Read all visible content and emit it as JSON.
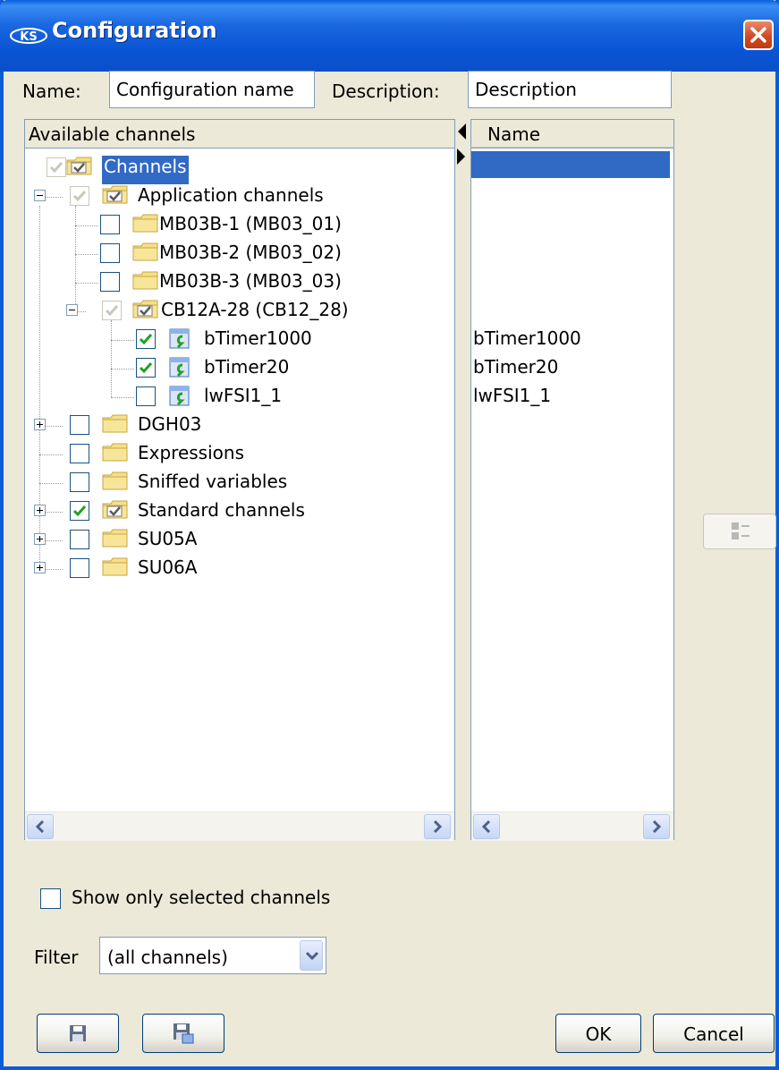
{
  "window": {
    "title": "Configuration"
  },
  "form": {
    "name_label": "Name:",
    "name_value": "Configuration name",
    "description_label": "Description:",
    "description_value": "Description"
  },
  "available": {
    "header": "Available channels",
    "tree": [
      {
        "label": "Channels",
        "state": "checked-disabled",
        "selected": true
      },
      {
        "label": "Application channels",
        "state": "checked-disabled",
        "expanded": true
      },
      {
        "label": "MB03B-1 (MB03_01)",
        "state": "unchecked"
      },
      {
        "label": "MB03B-2 (MB03_02)",
        "state": "unchecked"
      },
      {
        "label": "MB03B-3 (MB03_03)",
        "state": "unchecked"
      },
      {
        "label": "CB12A-28 (CB12_28)",
        "state": "checked-disabled",
        "expanded": true
      },
      {
        "label": "bTimer1000",
        "state": "checked"
      },
      {
        "label": "bTimer20",
        "state": "checked"
      },
      {
        "label": "lwFSI1_1",
        "state": "unchecked"
      },
      {
        "label": "DGH03",
        "state": "unchecked",
        "expanded": false
      },
      {
        "label": "Expressions",
        "state": "unchecked"
      },
      {
        "label": "Sniffed variables",
        "state": "unchecked"
      },
      {
        "label": "Standard channels",
        "state": "checked",
        "expanded": false
      },
      {
        "label": "SU05A",
        "state": "unchecked",
        "expanded": false
      },
      {
        "label": "SU06A",
        "state": "unchecked",
        "expanded": false
      }
    ]
  },
  "selected_list": {
    "header": "Name",
    "items": [
      "",
      "",
      "",
      "",
      "",
      "",
      "bTimer1000",
      "bTimer20",
      "lwFSI1_1"
    ]
  },
  "options": {
    "show_only_selected_label": "Show only selected channels",
    "show_only_selected_checked": false
  },
  "filter": {
    "label": "Filter",
    "value": "(all channels)"
  },
  "buttons": {
    "ok": "OK",
    "cancel": "Cancel"
  },
  "icons": {
    "close": "close-icon",
    "save": "save-icon",
    "save_as": "save-as-icon",
    "columns": "columns-icon",
    "folder": "folder-icon",
    "folder_checked": "folder-checked-icon",
    "variable": "variable-icon"
  },
  "colors": {
    "titlebar": "#0a55d4",
    "selection": "#316ac5",
    "dialog_bg": "#ece9d8",
    "check": "#21a121"
  }
}
